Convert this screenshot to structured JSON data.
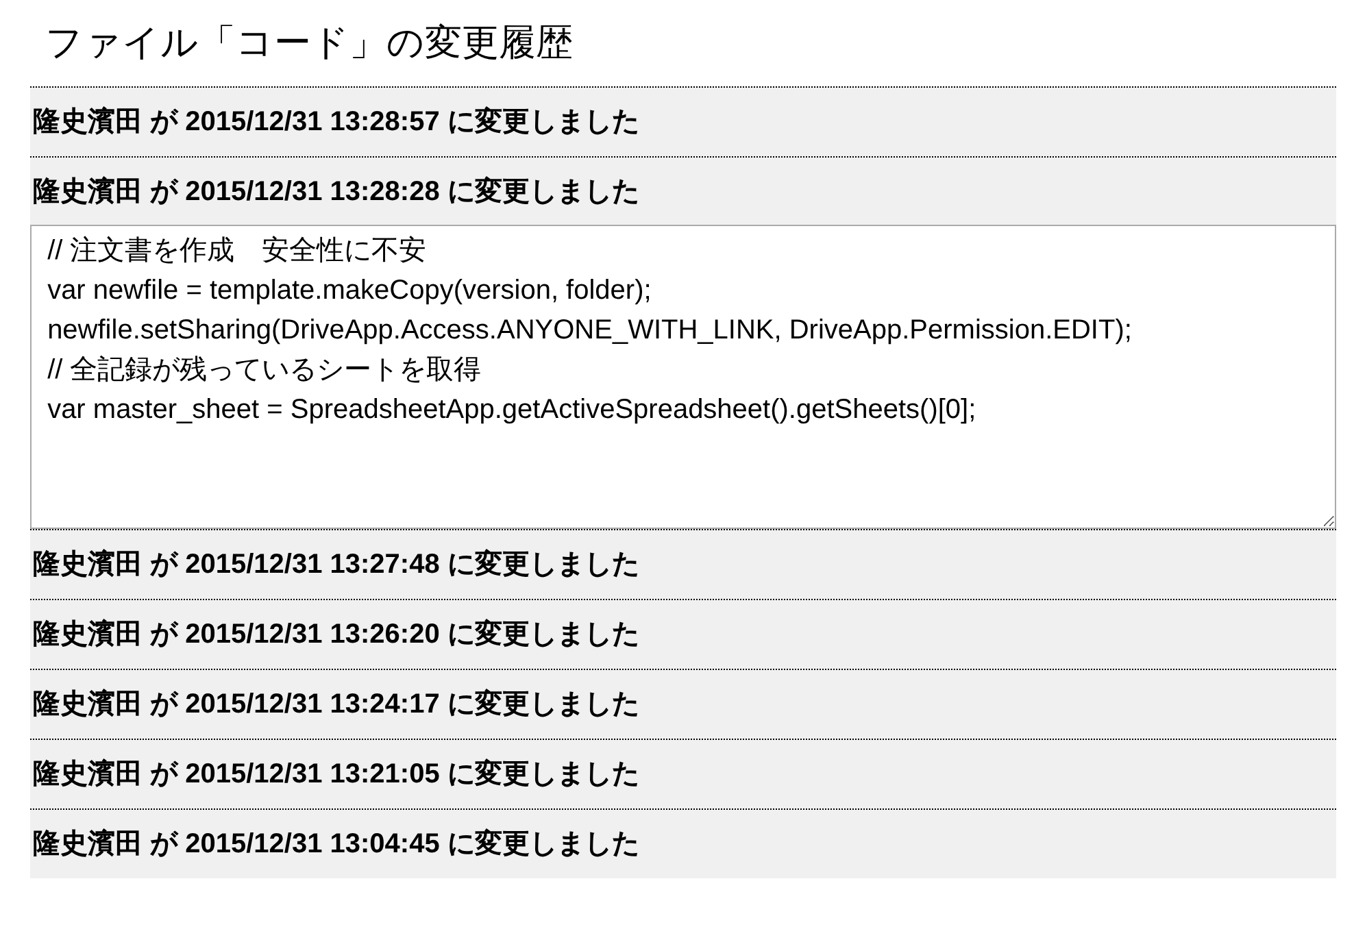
{
  "title": "ファイル「コード」の変更履歴",
  "history": [
    {
      "text": "隆史濱田 が 2015/12/31 13:28:57 に変更しました",
      "expanded": false
    },
    {
      "text": "隆史濱田 が 2015/12/31 13:28:28 に変更しました",
      "expanded": true,
      "code": " // 注文書を作成　安全性に不安\n var newfile = template.makeCopy(version, folder);\n newfile.setSharing(DriveApp.Access.ANYONE_WITH_LINK, DriveApp.Permission.EDIT);\n // 全記録が残っているシートを取得\n var master_sheet = SpreadsheetApp.getActiveSpreadsheet().getSheets()[0];"
    },
    {
      "text": "隆史濱田 が 2015/12/31 13:27:48 に変更しました",
      "expanded": false
    },
    {
      "text": "隆史濱田 が 2015/12/31 13:26:20 に変更しました",
      "expanded": false
    },
    {
      "text": "隆史濱田 が 2015/12/31 13:24:17 に変更しました",
      "expanded": false
    },
    {
      "text": "隆史濱田 が 2015/12/31 13:21:05 に変更しました",
      "expanded": false
    },
    {
      "text": "隆史濱田 が 2015/12/31 13:04:45 に変更しました",
      "expanded": false
    }
  ]
}
